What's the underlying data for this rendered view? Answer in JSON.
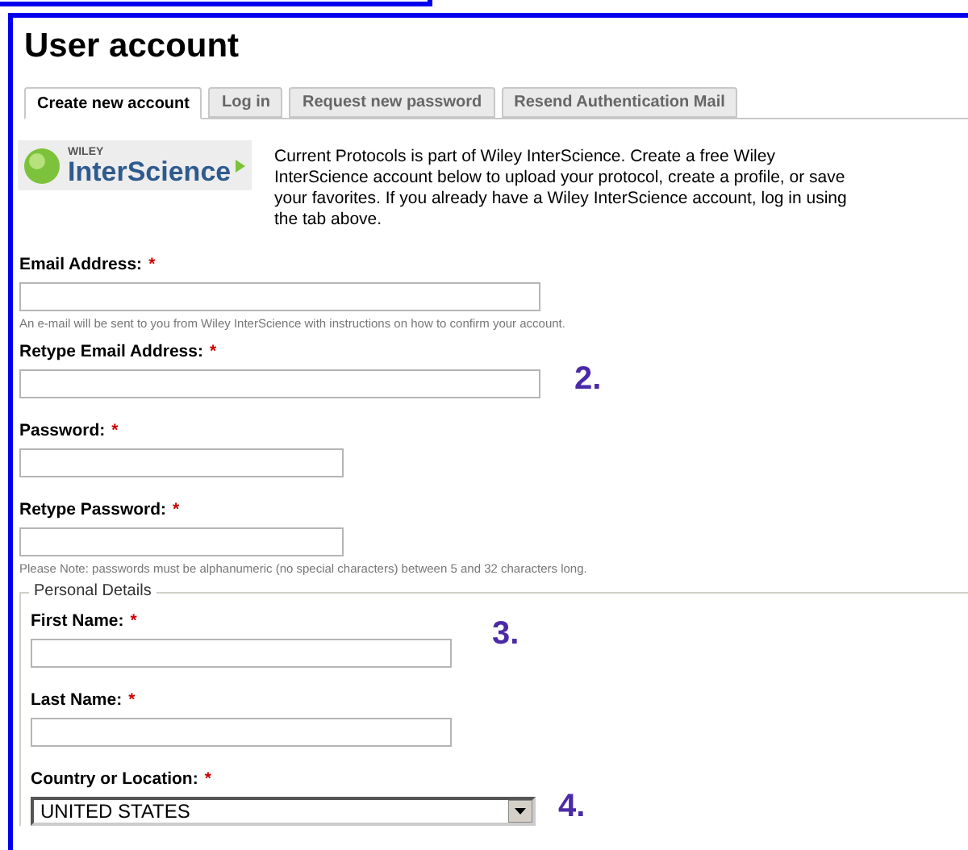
{
  "title": "User account",
  "tabs": [
    {
      "label": "Create new account",
      "selected": true
    },
    {
      "label": "Log in",
      "selected": false
    },
    {
      "label": "Request new password",
      "selected": false
    },
    {
      "label": "Resend Authentication Mail",
      "selected": false
    }
  ],
  "logo": {
    "brand": "WILEY",
    "name": "InterScience"
  },
  "intro_lines": [
    "Current Protocols is part of Wiley InterScience. Create a free Wiley",
    "InterScience account below to upload your protocol, create a profile, or save",
    "your favorites. If you already have a Wiley InterScience account, log in using",
    "the tab above."
  ],
  "account_fields": [
    {
      "label": "Email Address:",
      "required_mark": "*",
      "kind": "email",
      "help": "An e-mail will be sent to you from Wiley InterScience with instructions on how to confirm your account."
    },
    {
      "label": "Retype Email Address:",
      "required_mark": "*",
      "kind": "email",
      "annotation": "2."
    },
    {
      "label": "Password:",
      "required_mark": "*",
      "kind": "password"
    },
    {
      "label": "Retype Password:",
      "required_mark": "*",
      "kind": "password",
      "help": "Please Note: passwords must be alphanumeric (no special characters) between 5 and 32 characters long."
    }
  ],
  "personal_details": {
    "legend": "Personal Details",
    "annotation": "3.",
    "fields": [
      {
        "label": "First Name:",
        "required_mark": "*"
      },
      {
        "label": "Last Name:",
        "required_mark": "*"
      }
    ],
    "country": {
      "label": "Country or Location:",
      "required_mark": "*",
      "value": "UNITED STATES",
      "annotation": "4."
    }
  }
}
